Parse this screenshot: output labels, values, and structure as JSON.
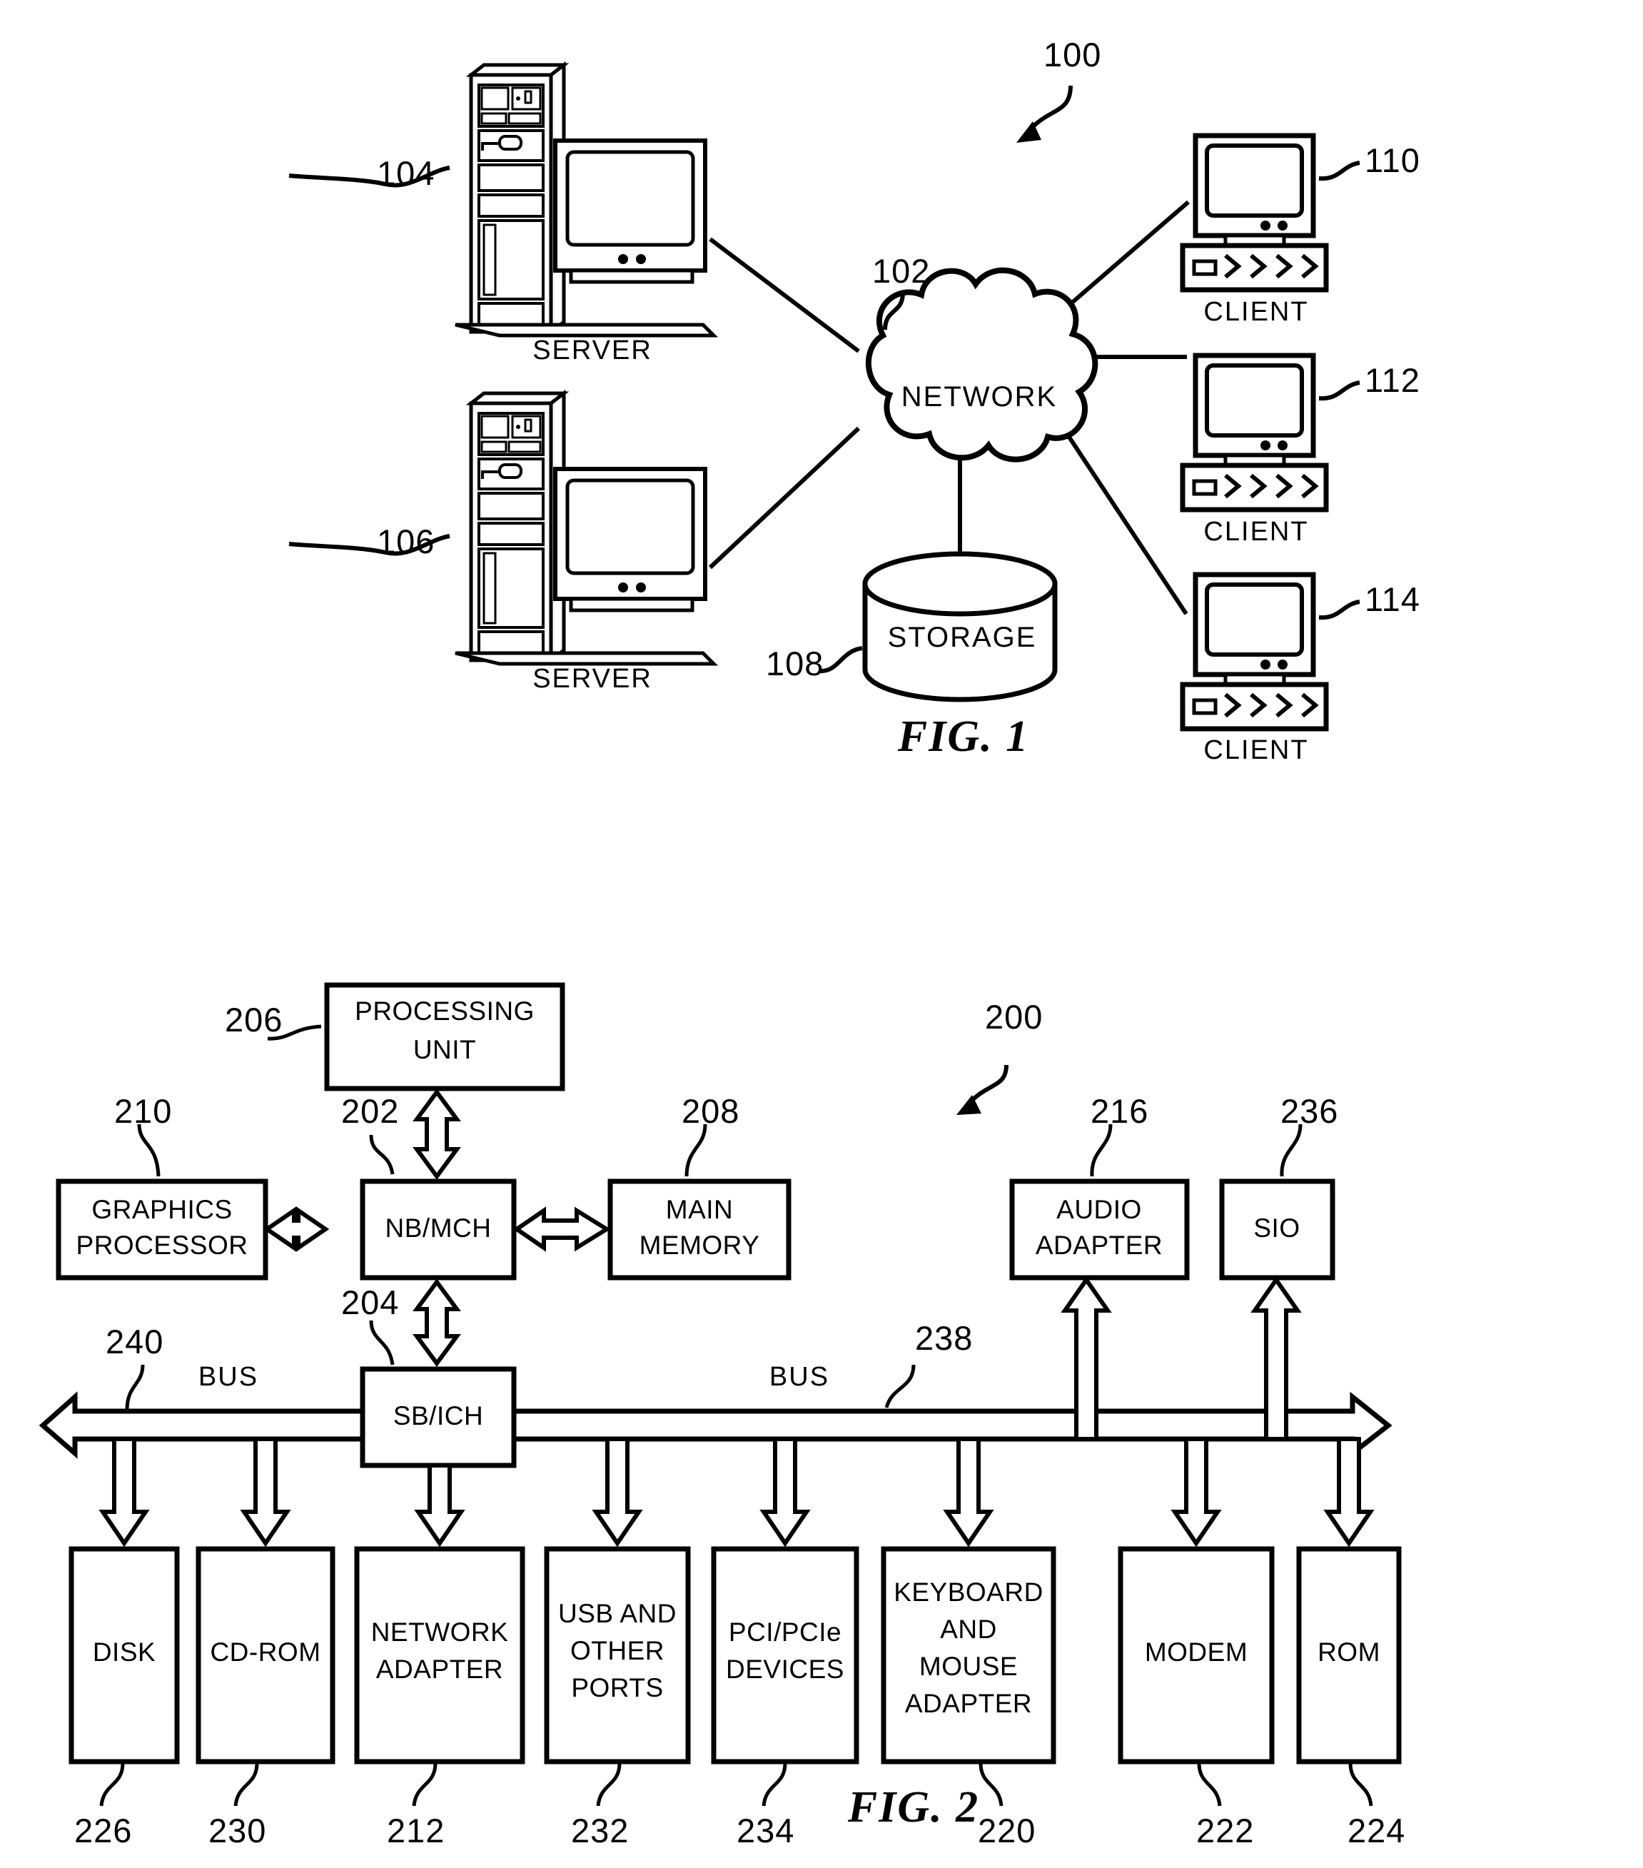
{
  "document": {
    "type": "patent-drawing-sheet",
    "figures": [
      "FIG. 1",
      "FIG. 2"
    ]
  },
  "fig1": {
    "caption": "FIG. 1",
    "system_ref": "100",
    "nodes": {
      "network": {
        "label": "NETWORK",
        "ref": "102"
      },
      "storage": {
        "label": "STORAGE",
        "ref": "108"
      },
      "server_top": {
        "label": "SERVER",
        "ref": "104"
      },
      "server_bottom": {
        "label": "SERVER",
        "ref": "106"
      },
      "client_top": {
        "label": "CLIENT",
        "ref": "110"
      },
      "client_middle": {
        "label": "CLIENT",
        "ref": "112"
      },
      "client_bottom": {
        "label": "CLIENT",
        "ref": "114"
      }
    }
  },
  "fig2": {
    "caption": "FIG. 2",
    "system_ref": "200",
    "blocks": {
      "processing_unit": {
        "label_line1": "PROCESSING",
        "label_line2": "UNIT",
        "ref": "206"
      },
      "nb_mch": {
        "label": "NB/MCH",
        "ref": "202"
      },
      "sb_ich": {
        "label": "SB/ICH",
        "ref": "204"
      },
      "graphics_processor": {
        "label_line1": "GRAPHICS",
        "label_line2": "PROCESSOR",
        "ref": "210"
      },
      "main_memory": {
        "label_line1": "MAIN",
        "label_line2": "MEMORY",
        "ref": "208"
      },
      "audio_adapter": {
        "label_line1": "AUDIO",
        "label_line2": "ADAPTER",
        "ref": "216"
      },
      "sio": {
        "label": "SIO",
        "ref": "236"
      },
      "disk": {
        "label": "DISK",
        "ref": "226"
      },
      "cd_rom": {
        "label": "CD-ROM",
        "ref": "230"
      },
      "network_adapter": {
        "label_line1": "NETWORK",
        "label_line2": "ADAPTER",
        "ref": "212"
      },
      "usb_ports": {
        "label_line1": "USB AND",
        "label_line2": "OTHER",
        "label_line3": "PORTS",
        "ref": "232"
      },
      "pci_devices": {
        "label_line1": "PCI/PCIe",
        "label_line2": "DEVICES",
        "ref": "234"
      },
      "keyboard_mouse": {
        "label_line1": "KEYBOARD",
        "label_line2": "AND",
        "label_line3": "MOUSE",
        "label_line4": "ADAPTER",
        "ref": "220"
      },
      "modem": {
        "label": "MODEM",
        "ref": "222"
      },
      "rom": {
        "label": "ROM",
        "ref": "224"
      }
    },
    "buses": {
      "left_bus": {
        "label": "BUS",
        "ref": "240"
      },
      "right_bus": {
        "label": "BUS",
        "ref": "238"
      }
    }
  },
  "colors": {
    "ink": "#000000",
    "paper": "#ffffff"
  }
}
